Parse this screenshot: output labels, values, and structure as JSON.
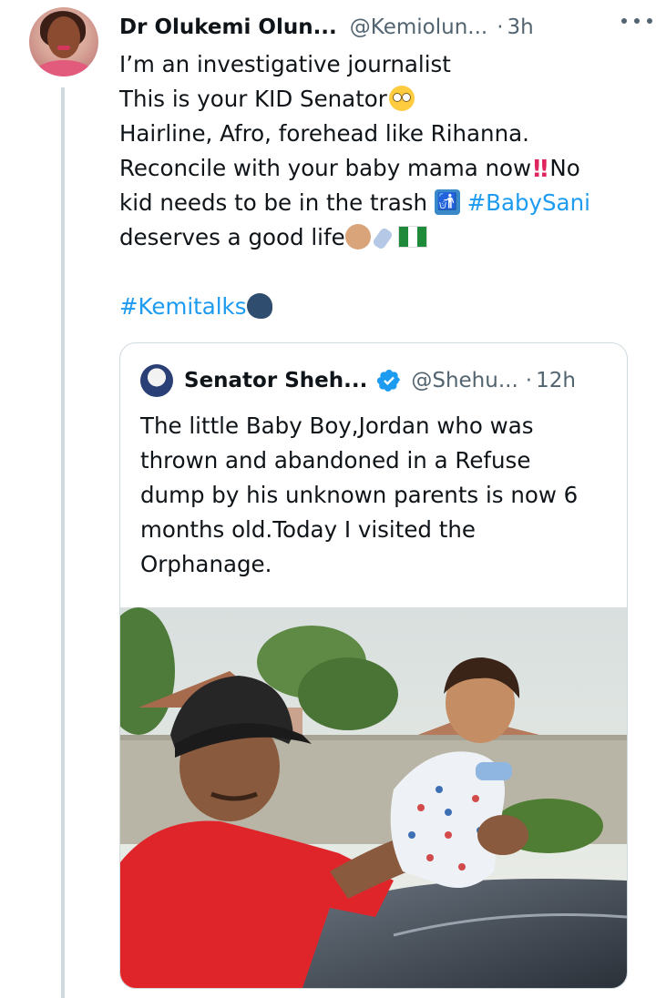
{
  "tweet": {
    "author_name": "Dr Olukemi Olun...",
    "author_handle": "@Kemiolun...",
    "separator": "·",
    "time": "3h",
    "text_lines": [
      "I’m an investigative journalist",
      "This is your KID Senator",
      "Hairline, Afro, forehead like Rihanna.",
      "Reconcile with your baby mama now",
      "No",
      "kid needs to be in the trash",
      "#BabySani",
      "deserves a good life",
      "#Kemitalks"
    ]
  },
  "quoted_tweet": {
    "author_name": "Senator Sheh...",
    "author_handle": "@Shehu...",
    "separator": "·",
    "time": "12h",
    "text_lines": [
      "The little Baby Boy,Jordan who was",
      "thrown and abandoned in a Refuse",
      "dump by his unknown parents is now 6",
      "months old.Today I visited the",
      "Orphanage."
    ]
  },
  "icons": {
    "more": "more-horizontal-icon",
    "verified": "verified-badge-icon",
    "emoji_rolling_eyes": "rolling-eyes-emoji",
    "emoji_double_exclamation": "double-exclamation-emoji",
    "emoji_litter_bin": "put-litter-in-bin-emoji",
    "emoji_baby": "baby-emoji",
    "emoji_bottle": "baby-bottle-emoji",
    "emoji_flag": "nigeria-flag-emoji",
    "emoji_speaking_head": "speaking-head-emoji"
  },
  "colors": {
    "text": "#0f1419",
    "secondary": "#536471",
    "link": "#1d9bf0",
    "border": "#cfd9de"
  }
}
